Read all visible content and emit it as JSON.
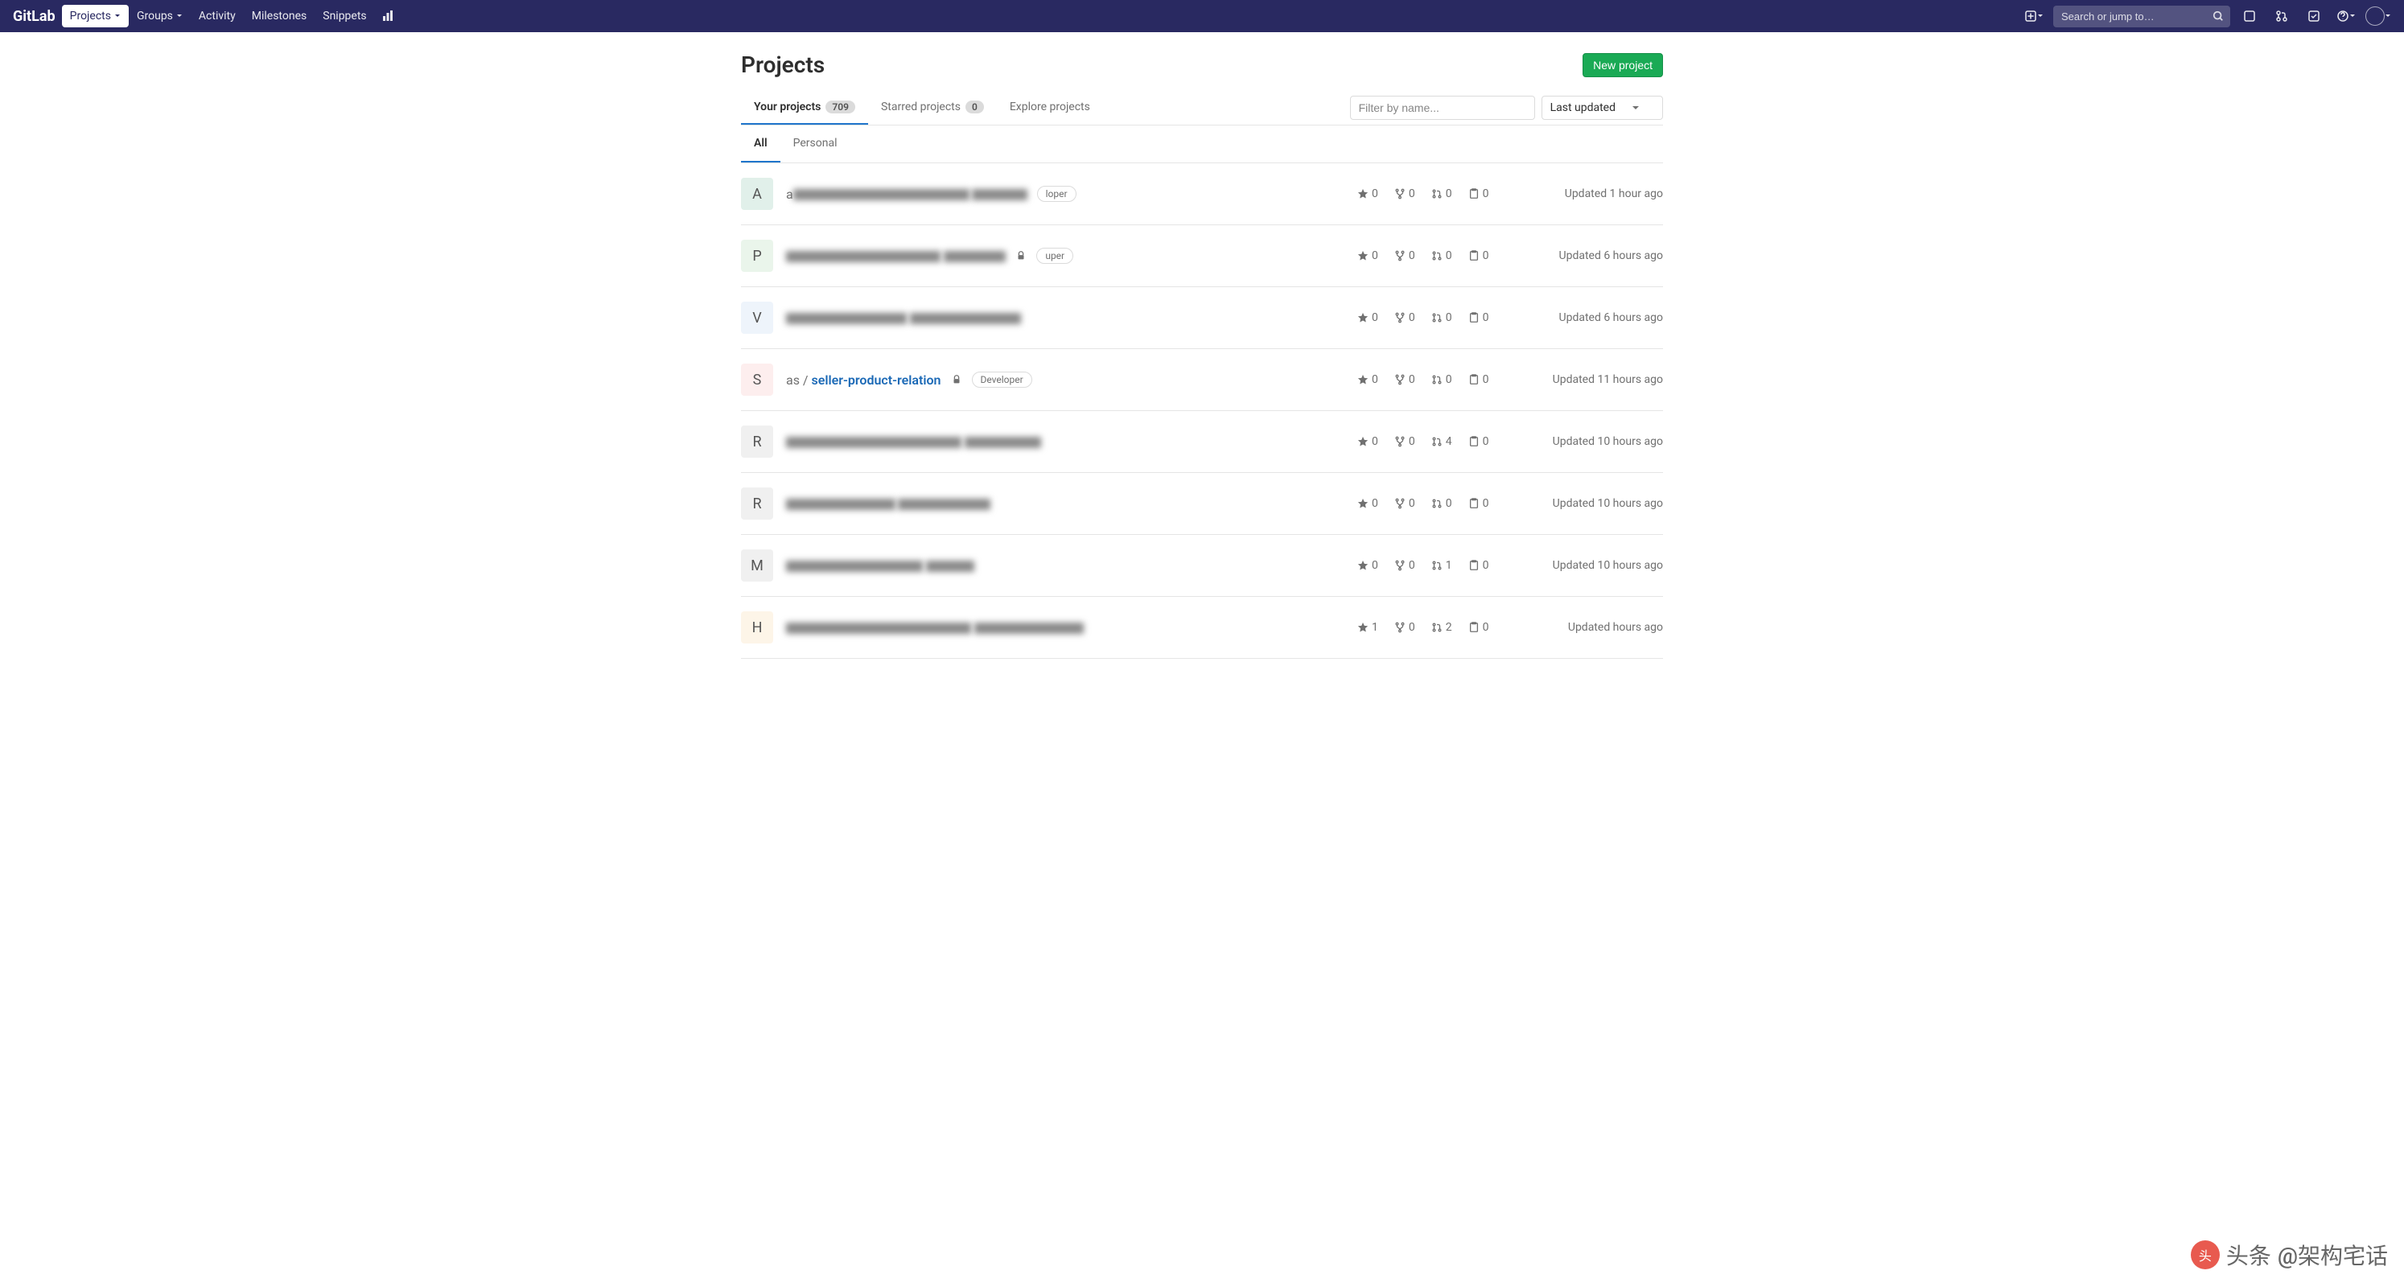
{
  "navbar": {
    "logo": "GitLab",
    "items": [
      {
        "label": "Projects",
        "active": true,
        "caret": true
      },
      {
        "label": "Groups",
        "active": false,
        "caret": true
      },
      {
        "label": "Activity",
        "active": false,
        "caret": false
      },
      {
        "label": "Milestones",
        "active": false,
        "caret": false
      },
      {
        "label": "Snippets",
        "active": false,
        "caret": false
      }
    ],
    "search_placeholder": "Search or jump to…"
  },
  "page": {
    "title": "Projects",
    "new_button": "New project"
  },
  "tabs": [
    {
      "label": "Your projects",
      "badge": "709",
      "active": true
    },
    {
      "label": "Starred projects",
      "badge": "0",
      "active": false
    },
    {
      "label": "Explore projects",
      "badge": null,
      "active": false
    }
  ],
  "filter_placeholder": "Filter by name...",
  "sort_label": "Last updated",
  "subtabs": [
    {
      "label": "All",
      "active": true
    },
    {
      "label": "Personal",
      "active": false
    }
  ],
  "projects": [
    {
      "letter": "A",
      "avatar_bg": "#e1f0ea",
      "name_prefix": "a",
      "name_blur": true,
      "role": "loper",
      "lock": false,
      "stars": "0",
      "forks": "0",
      "mrs": "0",
      "issues": "0",
      "updated": "Updated 1 hour ago"
    },
    {
      "letter": "P",
      "avatar_bg": "#eaf5eb",
      "name_prefix": "",
      "name_blur": true,
      "role": "uper",
      "lock": true,
      "stars": "0",
      "forks": "0",
      "mrs": "0",
      "issues": "0",
      "updated": "Updated 6 hours ago"
    },
    {
      "letter": "V",
      "avatar_bg": "#eef4fb",
      "name_prefix": "",
      "name_blur": true,
      "role": null,
      "lock": false,
      "stars": "0",
      "forks": "0",
      "mrs": "0",
      "issues": "0",
      "updated": "Updated 6 hours ago"
    },
    {
      "letter": "S",
      "avatar_bg": "#fdeeee",
      "name_prefix": "as / ",
      "name_full": "seller-product-relation",
      "name_blur": false,
      "role": "Developer",
      "lock": true,
      "stars": "0",
      "forks": "0",
      "mrs": "0",
      "issues": "0",
      "updated": "Updated 11 hours ago"
    },
    {
      "letter": "R",
      "avatar_bg": "#f0f0f0",
      "name_prefix": "",
      "name_blur": true,
      "role": null,
      "lock": false,
      "stars": "0",
      "forks": "0",
      "mrs": "4",
      "issues": "0",
      "updated": "Updated 10 hours ago"
    },
    {
      "letter": "R",
      "avatar_bg": "#f0f0f0",
      "name_prefix": "",
      "name_blur": true,
      "role": null,
      "lock": false,
      "stars": "0",
      "forks": "0",
      "mrs": "0",
      "issues": "0",
      "updated": "Updated 10 hours ago"
    },
    {
      "letter": "M",
      "avatar_bg": "#f0f0f0",
      "name_prefix": "",
      "name_blur": true,
      "role": null,
      "lock": false,
      "stars": "0",
      "forks": "0",
      "mrs": "1",
      "issues": "0",
      "updated": "Updated 10 hours ago"
    },
    {
      "letter": "H",
      "avatar_bg": "#fdf5e8",
      "name_prefix": "",
      "name_blur": true,
      "role": null,
      "lock": false,
      "stars": "1",
      "forks": "0",
      "mrs": "2",
      "issues": "0",
      "updated": "Updated hours ago"
    }
  ],
  "watermark": {
    "prefix": "头条",
    "handle": "@架构宅话"
  }
}
